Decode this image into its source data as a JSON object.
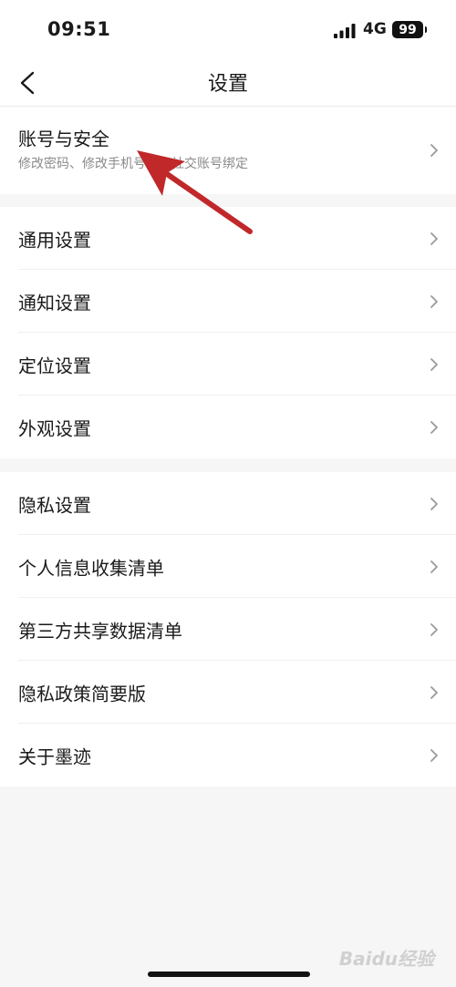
{
  "status_bar": {
    "time": "09:51",
    "network": "4G",
    "battery": "99"
  },
  "nav": {
    "title": "设置"
  },
  "account": {
    "label": "账号与安全",
    "subtitle": "修改密码、修改手机号码、社交账号绑定"
  },
  "general_group": [
    {
      "label": "通用设置"
    },
    {
      "label": "通知设置"
    },
    {
      "label": "定位设置"
    },
    {
      "label": "外观设置"
    }
  ],
  "privacy_group": [
    {
      "label": "隐私设置"
    },
    {
      "label": "个人信息收集清单"
    },
    {
      "label": "第三方共享数据清单"
    },
    {
      "label": "隐私政策简要版"
    },
    {
      "label": "关于墨迹"
    }
  ],
  "watermark": "Baidu经验",
  "colors": {
    "background": "#f6f6f6",
    "card": "#ffffff",
    "arrow": "#c0282a",
    "subtext": "#8a8a8a"
  }
}
